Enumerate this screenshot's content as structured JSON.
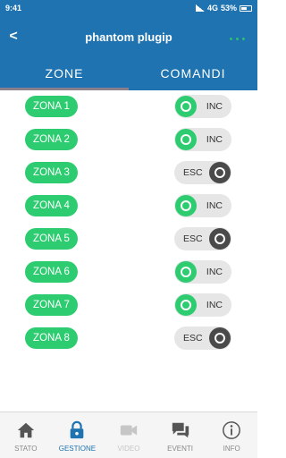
{
  "status_bar": {
    "time": "9:41",
    "network": "4G",
    "battery": "53%"
  },
  "app_bar": {
    "back_label": "<",
    "title": "phantom plugip"
  },
  "tabs": [
    {
      "label": "ZONE",
      "active": true
    },
    {
      "label": "COMANDI",
      "active": false
    }
  ],
  "zones": [
    {
      "name": "ZONA 1",
      "state_label": "INC",
      "on": true
    },
    {
      "name": "ZONA 2",
      "state_label": "INC",
      "on": true
    },
    {
      "name": "ZONA 3",
      "state_label": "ESC",
      "on": false
    },
    {
      "name": "ZONA 4",
      "state_label": "INC",
      "on": true
    },
    {
      "name": "ZONA 5",
      "state_label": "ESC",
      "on": false
    },
    {
      "name": "ZONA 6",
      "state_label": "INC",
      "on": true
    },
    {
      "name": "ZONA 7",
      "state_label": "INC",
      "on": true
    },
    {
      "name": "ZONA 8",
      "state_label": "ESC",
      "on": false
    }
  ],
  "bottom_nav": [
    {
      "label": "STATO",
      "icon": "home-icon",
      "state": "normal"
    },
    {
      "label": "GESTIONE",
      "icon": "lock-icon",
      "state": "active"
    },
    {
      "label": "VIDEO",
      "icon": "video-camera-icon",
      "state": "disabled"
    },
    {
      "label": "EVENTI",
      "icon": "chat-bubbles-icon",
      "state": "normal"
    },
    {
      "label": "INFO",
      "icon": "info-icon",
      "state": "normal"
    }
  ],
  "colors": {
    "primary_blue": "#1e73b0",
    "zone_green": "#2ecc71",
    "toggle_off_dark": "#4a4a4a",
    "nav_gray": "#888888"
  }
}
